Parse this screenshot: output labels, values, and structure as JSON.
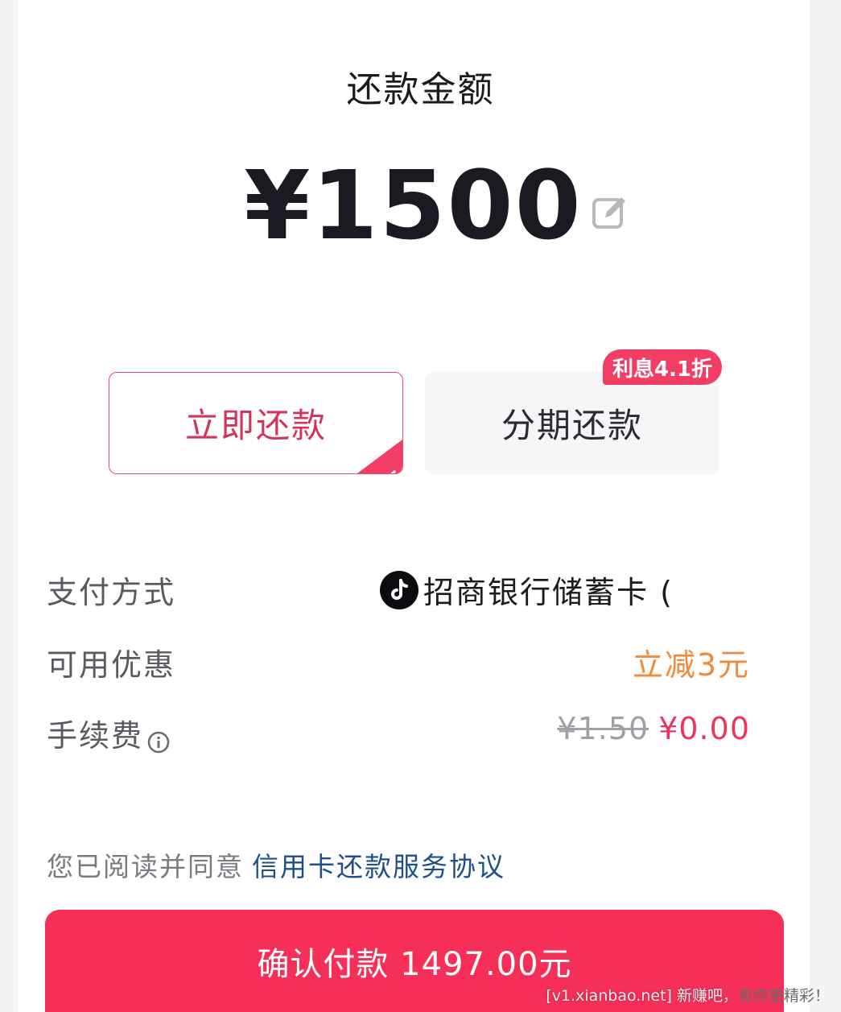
{
  "header": {
    "title": "还款金额"
  },
  "amount": {
    "value": "¥1500"
  },
  "options": {
    "immediate_label": "立即还款",
    "installment_label": "分期还款",
    "installment_badge": "利息4.1折",
    "selected": "immediate"
  },
  "payment": {
    "method_label": "支付方式",
    "method_value": "招商银行储蓄卡 (",
    "promo_label": "可用优惠",
    "promo_value": "立减3元",
    "fee_label": "手续费",
    "fee_original": "¥1.50",
    "fee_current": "¥0.00"
  },
  "agreement": {
    "prefix": "您已阅读并同意",
    "link_text": "信用卡还款服务协议"
  },
  "confirm": {
    "label": "确认付款 1497.00元"
  },
  "watermark": {
    "text_a": "[v1.xianbao.net] 新赚吧，",
    "text_b": "有你更精彩！"
  },
  "colors": {
    "accent": "#f52f58",
    "promo": "#f08a3c",
    "link": "#1f4f8a"
  },
  "icons": [
    "edit-icon",
    "check-icon",
    "tiktok-icon",
    "info-icon"
  ]
}
